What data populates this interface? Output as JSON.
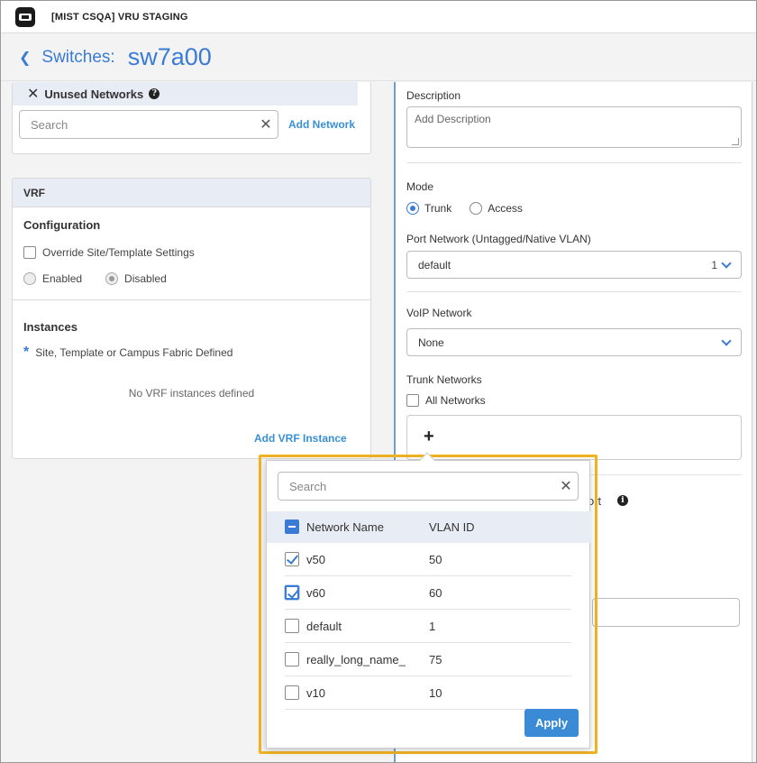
{
  "topbar": {
    "org_title": "[MIST CSQA] VRU STAGING"
  },
  "header": {
    "breadcrumb": "Switches:",
    "device_name": "sw7a00"
  },
  "unused_networks": {
    "title": "Unused Networks",
    "search_placeholder": "Search",
    "add_label": "Add Network"
  },
  "vrf": {
    "title": "VRF",
    "configuration_title": "Configuration",
    "override_label": "Override Site/Template Settings",
    "enabled_label": "Enabled",
    "disabled_label": "Disabled",
    "instances_title": "Instances",
    "defined_note": "Site, Template or Campus Fabric Defined",
    "empty_text": "No VRF instances defined",
    "add_instance_label": "Add VRF Instance"
  },
  "port_config": {
    "description_label": "Description",
    "description_placeholder": "Add Description",
    "mode_label": "Mode",
    "mode_trunk": "Trunk",
    "mode_access": "Access",
    "port_network_label": "Port Network (Untagged/Native VLAN)",
    "port_network_value": "default",
    "port_network_count": "1",
    "voip_label": "VoIP Network",
    "voip_value": "None",
    "trunk_label": "Trunk Networks",
    "all_networks_label": "All Networks",
    "partial_label": "ort"
  },
  "network_picker": {
    "search_placeholder": "Search",
    "col_name": "Network Name",
    "col_vlan": "VLAN ID",
    "rows": [
      {
        "name": "v50",
        "vlan": "50",
        "checked": true
      },
      {
        "name": "v60",
        "vlan": "60",
        "checked": true
      },
      {
        "name": "default",
        "vlan": "1",
        "checked": false
      },
      {
        "name": "really_long_name_",
        "vlan": "75",
        "checked": false
      },
      {
        "name": "v10",
        "vlan": "10",
        "checked": false
      }
    ],
    "apply_label": "Apply"
  }
}
